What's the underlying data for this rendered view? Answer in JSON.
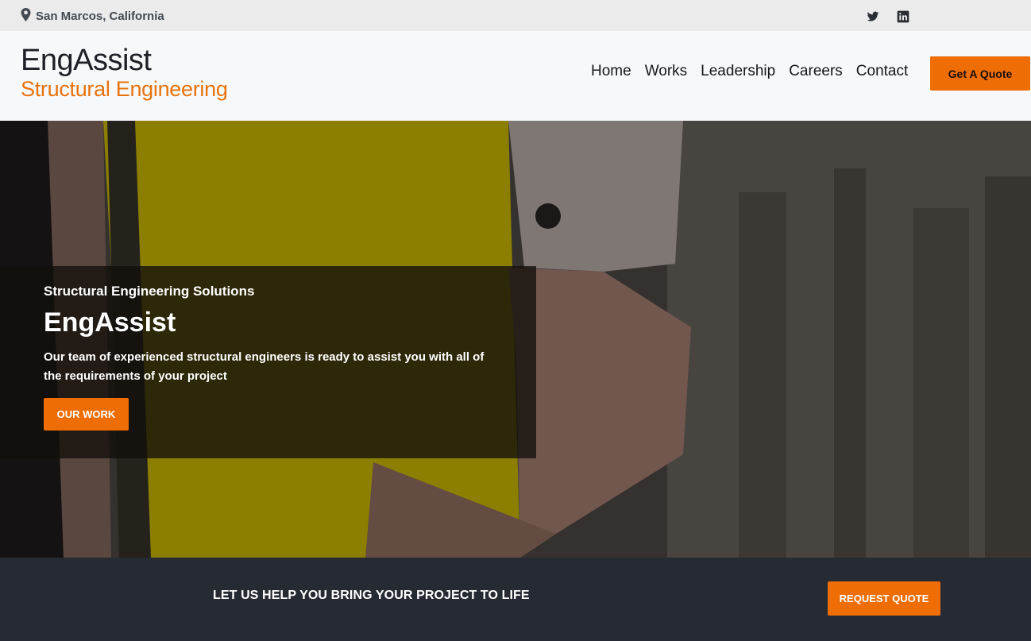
{
  "topbar": {
    "location": "San Marcos, California",
    "icons": [
      "map-pin-icon",
      "twitter-icon",
      "linkedin-icon"
    ]
  },
  "header": {
    "brand_name": "EngAssist",
    "brand_subtitle": "Structural Engineering",
    "nav": [
      "Home",
      "Works",
      "Leadership",
      "Careers",
      "Contact"
    ],
    "quote_button": "Get A Quote"
  },
  "hero": {
    "kicker": "Structural Engineering Solutions",
    "title": "EngAssist",
    "text": "Our team of experienced structural engineers is ready to assist you with all of the requirements of your project",
    "button": "OUR WORK"
  },
  "cta": {
    "text": "LET US HELP YOU BRING YOUR PROJECT TO LIFE",
    "button": "REQUEST QUOTE"
  },
  "colors": {
    "accent": "#ee6d05",
    "brand_subtitle": "#e8720c",
    "topbar_bg": "#ebebeb",
    "header_bg": "#f7f8fa",
    "cta_bg": "#262b33"
  }
}
